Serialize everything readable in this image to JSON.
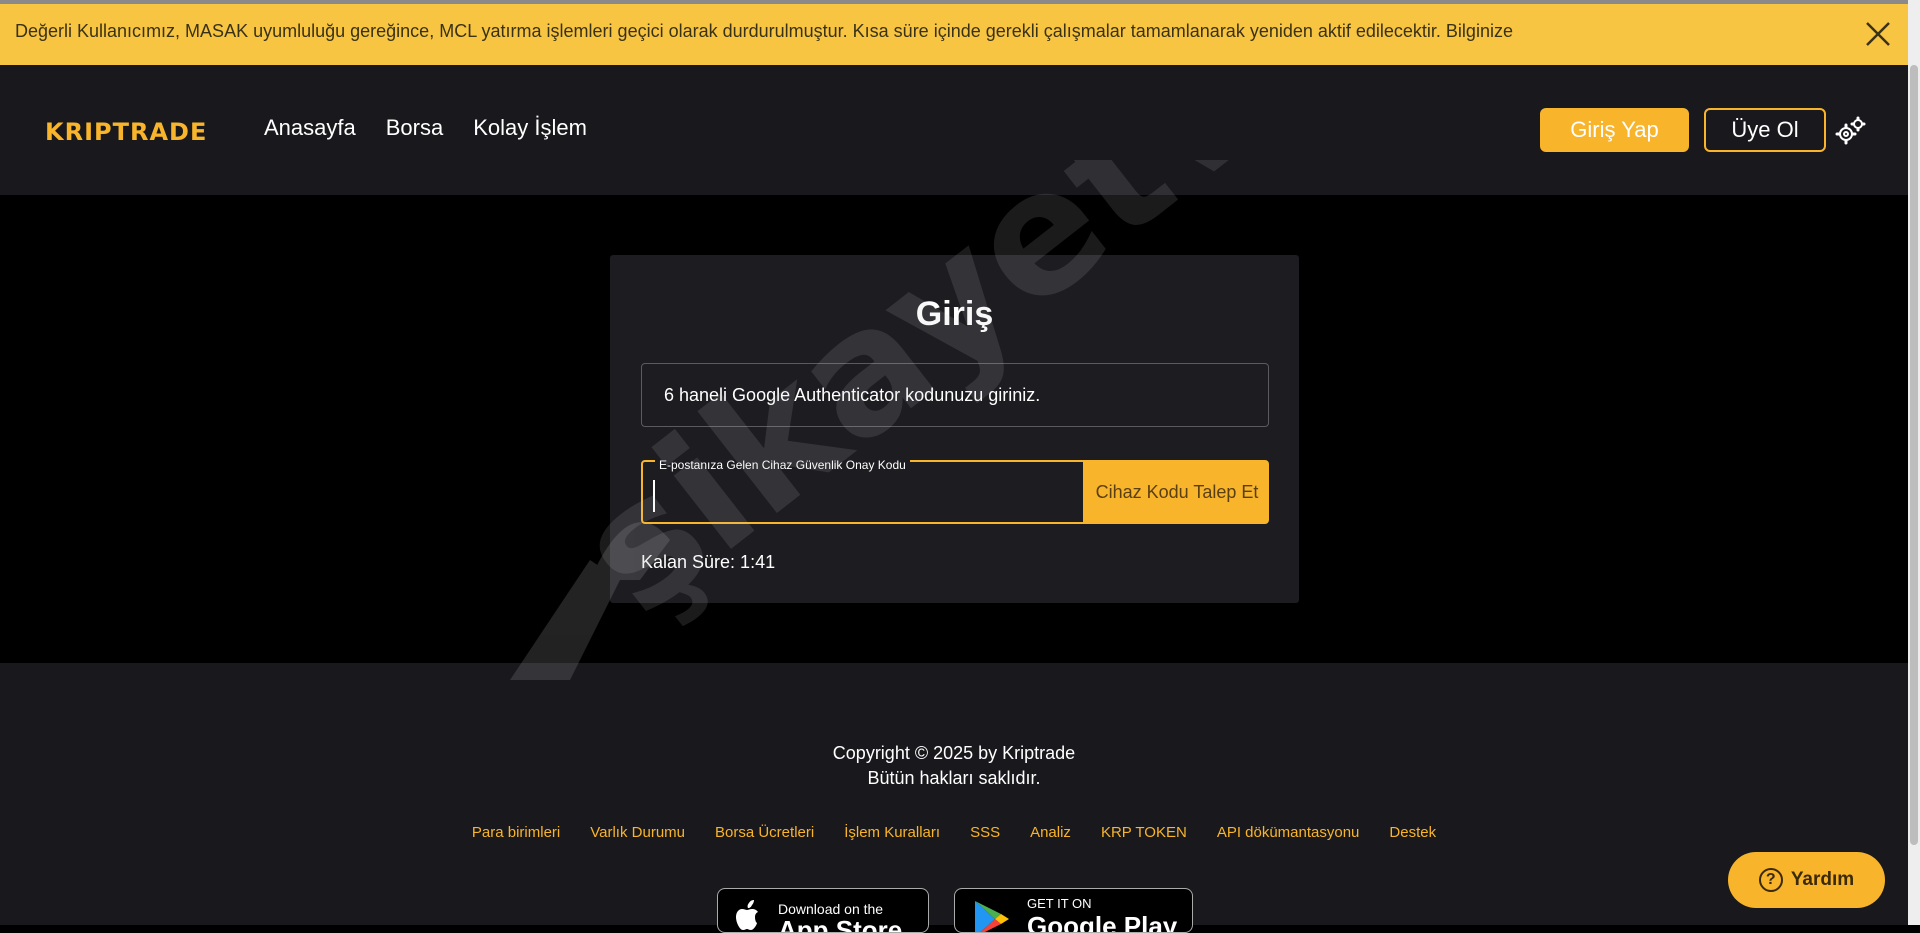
{
  "announcement": {
    "text": "Değerli Kullanıcımız, MASAK uyumluluğu gereğince, MCL yatırma işlemleri geçici olarak durdurulmuştur. Kısa süre içinde gerekli çalışmalar tamamlanarak yeniden aktif edilecektir. Bilginize"
  },
  "header": {
    "logo": "KRIPTRADE",
    "nav": [
      "Anasayfa",
      "Borsa",
      "Kolay İşlem"
    ],
    "login_label": "Giriş Yap",
    "signup_label": "Üye Ol"
  },
  "login_card": {
    "title": "Giriş",
    "info": "6 haneli Google Authenticator kodunuzu giriniz.",
    "code_label": "E-postanıza Gelen Cihaz Güvenlik Onay Kodu",
    "code_value": "",
    "request_button": "Cihaz Kodu Talep Et",
    "timer_text": "Kalan Süre: 1:41"
  },
  "footer": {
    "copyright_line1": "Copyright © 2025 by Kriptrade",
    "copyright_line2": "Bütün hakları saklıdır.",
    "links": [
      "Para birimleri",
      "Varlık Durumu",
      "Borsa Ücretleri",
      "İşlem Kuralları",
      "SSS",
      "Analiz",
      "KRP TOKEN",
      "API dökümantasyonu",
      "Destek"
    ],
    "appstore_small": "Download on the",
    "appstore_big": "App Store",
    "gplay_small": "GET IT ON",
    "gplay_big": "Google Play"
  },
  "help": {
    "label": "Yardım"
  },
  "watermark": "şikayetvar",
  "colors": {
    "accent": "#f8b42b",
    "announce_bg": "#f8c543",
    "header_bg": "#18181d",
    "card_bg": "#1c1c21"
  }
}
